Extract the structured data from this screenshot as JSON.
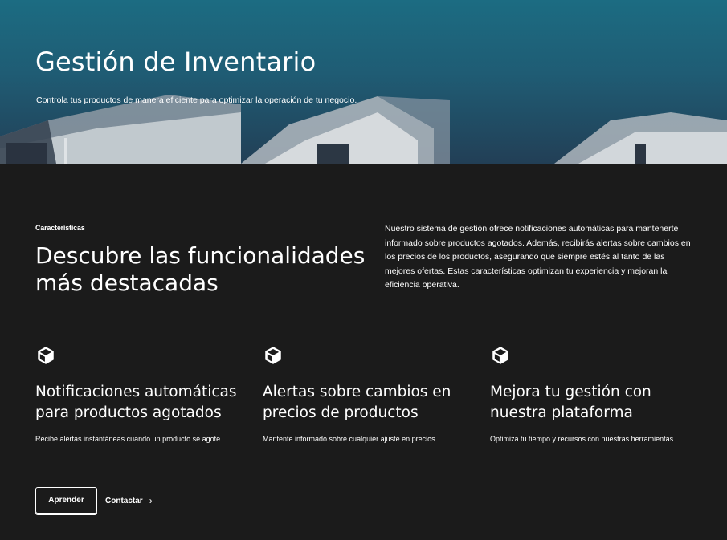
{
  "hero": {
    "title": "Gestión de Inventario",
    "subtitle": "Controla tus productos de manera eficiente para optimizar la operación de tu negocio."
  },
  "features_section": {
    "eyebrow": "Características",
    "headline": "Descubre las funcionalidades más destacadas",
    "intro": "Nuestro sistema de gestión ofrece notificaciones automáticas para mantenerte informado sobre productos agotados. Además, recibirás alertas sobre cambios en los precios de los productos, asegurando que siempre estés al tanto de las mejores ofertas. Estas características optimizan tu experiencia y mejoran la eficiencia operativa.",
    "items": [
      {
        "icon": "cube-icon",
        "title": "Notificaciones automáticas para productos agotados",
        "description": "Recibe alertas instantáneas cuando un producto se agote."
      },
      {
        "icon": "cube-icon",
        "title": "Alertas sobre cambios en precios de productos",
        "description": "Mantente informado sobre cualquier ajuste en precios."
      },
      {
        "icon": "cube-icon",
        "title": "Mejora tu gestión con nuestra plataforma",
        "description": "Optimiza tu tiempo y recursos con nuestras herramientas."
      }
    ]
  },
  "actions": {
    "primary_label": "Aprender",
    "secondary_label": "Contactar",
    "secondary_icon": "chevron-right-icon"
  },
  "colors": {
    "background": "#1b1b1b",
    "hero_top": "#1c6c82",
    "hero_bottom": "#223f56",
    "text": "#ffffff"
  }
}
